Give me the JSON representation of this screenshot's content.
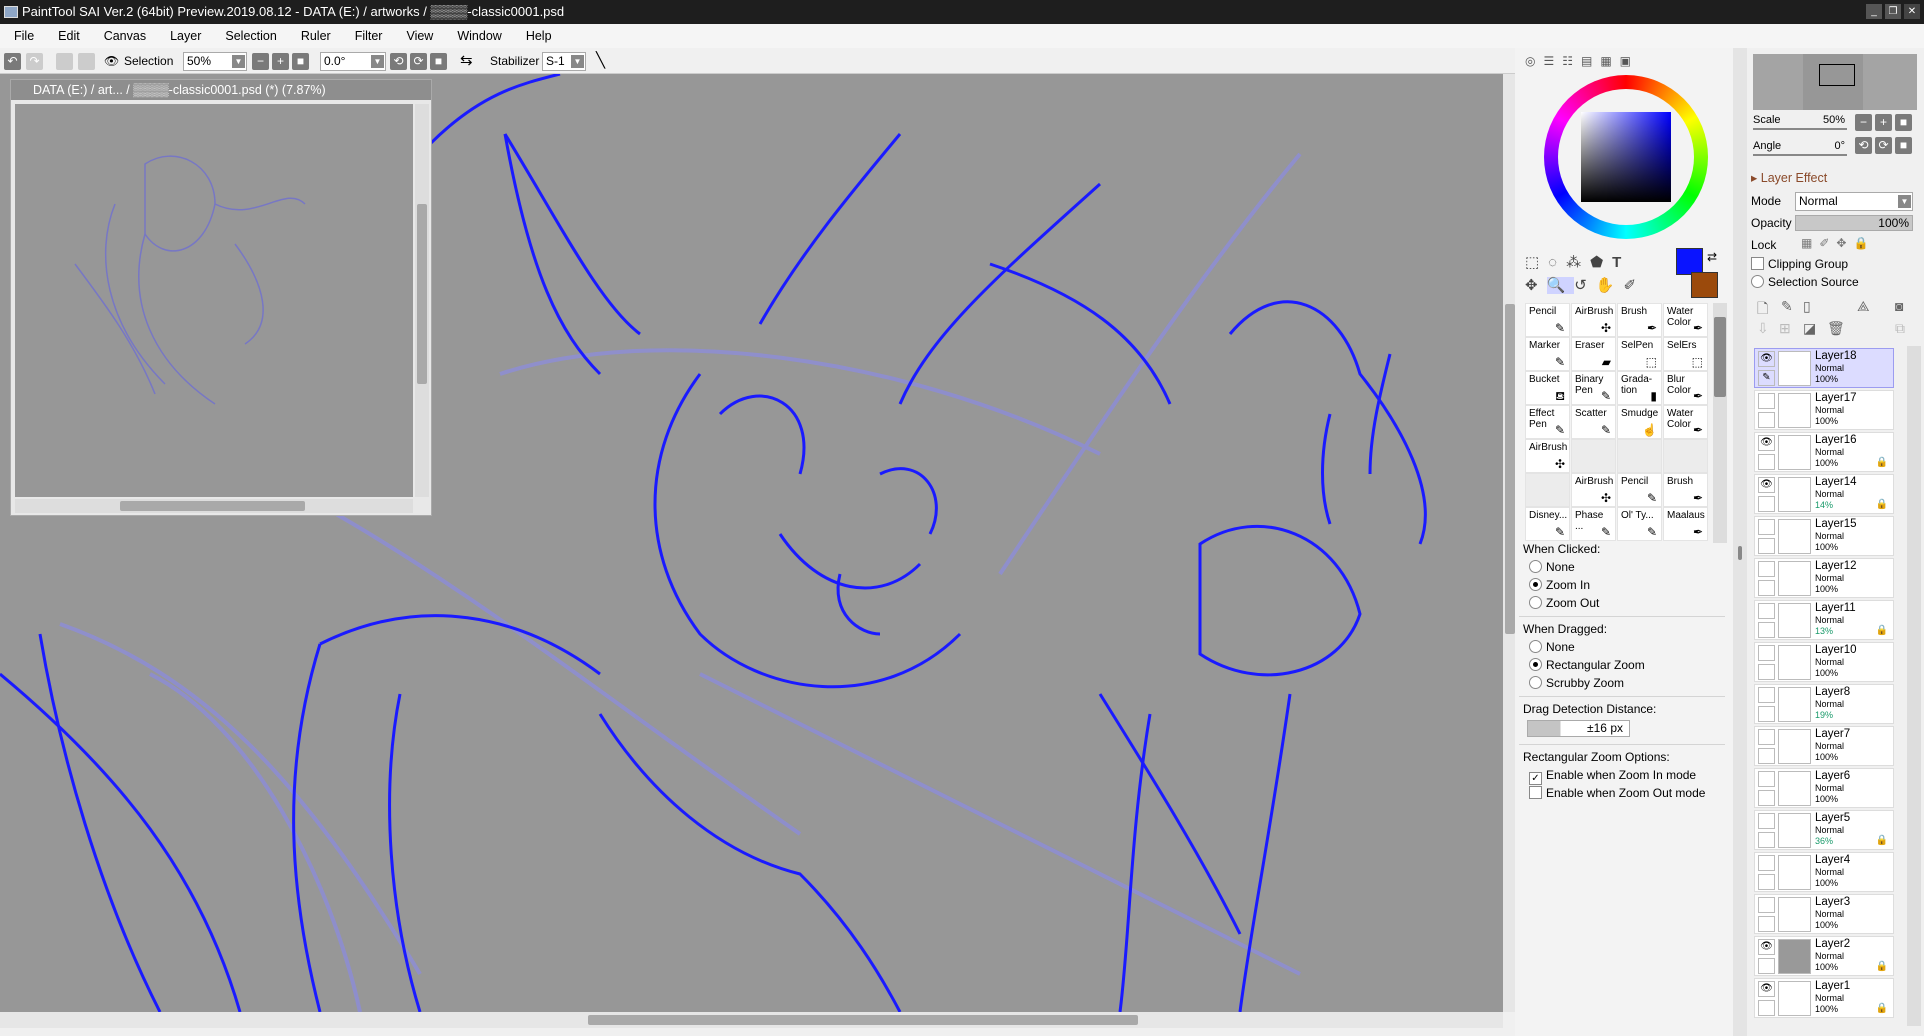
{
  "title": "PaintTool SAI Ver.2 (64bit) Preview.2019.08.12 - DATA (E:) / artworks / ▒▒▒▒-classic0001.psd",
  "menu": [
    "File",
    "Edit",
    "Canvas",
    "Layer",
    "Selection",
    "Ruler",
    "Filter",
    "View",
    "Window",
    "Help"
  ],
  "toolbar": {
    "selection_label": "Selection",
    "zoom": "50%",
    "angle": "0.0°",
    "stabilizer_label": "Stabilizer",
    "stabilizer": "S-1"
  },
  "navigator": {
    "title": "DATA (E:) / art...   / ▒▒▒▒-classic0001.psd (*) (7.87%)"
  },
  "colors": {
    "primary": "#0a14ff",
    "secondary": "#9b4a0c",
    "sketch": "#1a1aff",
    "canvas_bg": "#979797"
  },
  "tools": [
    {
      "label": "Pencil",
      "icon": "✎"
    },
    {
      "label": "AirBrush",
      "icon": "✣"
    },
    {
      "label": "Brush",
      "icon": "✒"
    },
    {
      "label": "Water Color",
      "icon": "✒"
    },
    {
      "label": "Marker",
      "icon": "✎"
    },
    {
      "label": "Eraser",
      "icon": "▰"
    },
    {
      "label": "SelPen",
      "icon": "⬚"
    },
    {
      "label": "SelErs",
      "icon": "⬚"
    },
    {
      "label": "Bucket",
      "icon": "⛾"
    },
    {
      "label": "Binary Pen",
      "icon": "✎"
    },
    {
      "label": "Grada- tion",
      "icon": "▮"
    },
    {
      "label": "Blur Color",
      "icon": "✒"
    },
    {
      "label": "Effect Pen",
      "icon": "✎"
    },
    {
      "label": "Scatter",
      "icon": "✎"
    },
    {
      "label": "Smudge",
      "icon": "☝"
    },
    {
      "label": "Water Color",
      "icon": "✒"
    },
    {
      "label": "AirBrush",
      "icon": "✣"
    },
    {
      "label": "",
      "icon": ""
    },
    {
      "label": "",
      "icon": ""
    },
    {
      "label": "",
      "icon": ""
    },
    {
      "label": "",
      "icon": ""
    },
    {
      "label": "AirBrush",
      "icon": "✣"
    },
    {
      "label": "Pencil",
      "icon": "✎"
    },
    {
      "label": "Brush",
      "icon": "✒"
    },
    {
      "label": "Disney...",
      "icon": "✎"
    },
    {
      "label": "Phase ...",
      "icon": "✎"
    },
    {
      "label": "Ol' Ty...",
      "icon": "✎"
    },
    {
      "label": "Maalaus",
      "icon": "✒"
    }
  ],
  "zoom_options": {
    "when_clicked": "When Clicked:",
    "clicked_opts": [
      "None",
      "Zoom In",
      "Zoom Out"
    ],
    "clicked_selected": 1,
    "when_dragged": "When Dragged:",
    "dragged_opts": [
      "None",
      "Rectangular Zoom",
      "Scrubby Zoom"
    ],
    "dragged_selected": 1,
    "drag_distance_label": "Drag Detection Distance:",
    "drag_distance": "±16 px",
    "rect_label": "Rectangular Zoom Options:",
    "rect_opts": [
      {
        "label": "Enable when Zoom In mode",
        "checked": true
      },
      {
        "label": "Enable when Zoom Out mode",
        "checked": false
      }
    ]
  },
  "view": {
    "scale_label": "Scale",
    "scale": "50%",
    "angle_label": "Angle",
    "angle": "0°"
  },
  "layer_props": {
    "effect": "Layer Effect",
    "mode_label": "Mode",
    "mode": "Normal",
    "opacity_label": "Opacity",
    "opacity": "100%",
    "lock_label": "Lock",
    "clipping": "Clipping Group",
    "selection_source": "Selection Source"
  },
  "layers": [
    {
      "name": "Layer18",
      "mode": "Normal",
      "opacity": "100%",
      "visible": true,
      "locked": false,
      "selected": true
    },
    {
      "name": "Layer17",
      "mode": "Normal",
      "opacity": "100%",
      "visible": false,
      "locked": false
    },
    {
      "name": "Layer16",
      "mode": "Normal",
      "opacity": "100%",
      "visible": true,
      "locked": true
    },
    {
      "name": "Layer14",
      "mode": "Normal",
      "opacity": "14%",
      "visible": true,
      "locked": true
    },
    {
      "name": "Layer15",
      "mode": "Normal",
      "opacity": "100%",
      "visible": false,
      "locked": false
    },
    {
      "name": "Layer12",
      "mode": "Normal",
      "opacity": "100%",
      "visible": false,
      "locked": false
    },
    {
      "name": "Layer11",
      "mode": "Normal",
      "opacity": "13%",
      "visible": false,
      "locked": true
    },
    {
      "name": "Layer10",
      "mode": "Normal",
      "opacity": "100%",
      "visible": false,
      "locked": false
    },
    {
      "name": "Layer8",
      "mode": "Normal",
      "opacity": "19%",
      "visible": false,
      "locked": false
    },
    {
      "name": "Layer7",
      "mode": "Normal",
      "opacity": "100%",
      "visible": false,
      "locked": false
    },
    {
      "name": "Layer6",
      "mode": "Normal",
      "opacity": "100%",
      "visible": false,
      "locked": false
    },
    {
      "name": "Layer5",
      "mode": "Normal",
      "opacity": "36%",
      "visible": false,
      "locked": true
    },
    {
      "name": "Layer4",
      "mode": "Normal",
      "opacity": "100%",
      "visible": false,
      "locked": false
    },
    {
      "name": "Layer3",
      "mode": "Normal",
      "opacity": "100%",
      "visible": false,
      "locked": false
    },
    {
      "name": "Layer2",
      "mode": "Normal",
      "opacity": "100%",
      "visible": true,
      "locked": true,
      "gray": true
    },
    {
      "name": "Layer1",
      "mode": "Normal",
      "opacity": "100%",
      "visible": true,
      "locked": true
    }
  ]
}
